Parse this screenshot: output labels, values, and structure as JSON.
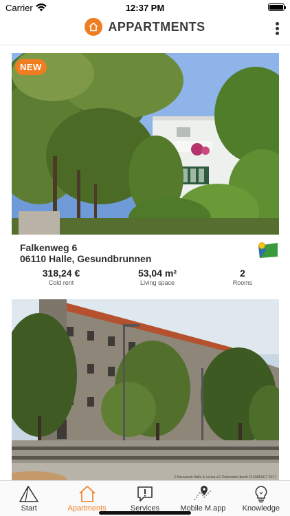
{
  "status_bar": {
    "carrier": "Carrier",
    "time": "12:37 PM"
  },
  "header": {
    "title": "APPARTMENTS"
  },
  "listings": [
    {
      "badge": "NEW",
      "street": "Falkenweg 6",
      "city": "06110 Halle, Gesundbrunnen",
      "cold_rent": "318,24 €",
      "cold_rent_label": "Cold rent",
      "living_space": "53,04 m²",
      "living_space_label": "Living space",
      "rooms": "2",
      "rooms_label": "Rooms"
    },
    {
      "photo_credit": "© Bauverein Halle & Leuna eG Präsentiert durch FLOWFACT 2017"
    }
  ],
  "tab_bar": {
    "items": [
      {
        "label": "Start",
        "icon": "triangle-icon"
      },
      {
        "label": "Apartments",
        "icon": "house-icon"
      },
      {
        "label": "Services",
        "icon": "chat-exclamation-icon"
      },
      {
        "label": "Mobile M.app",
        "icon": "map-pin-icon"
      },
      {
        "label": "Knowledge",
        "icon": "lightbulb-icon"
      }
    ],
    "active": "Apartments"
  },
  "colors": {
    "accent": "#ef7d21",
    "title": "#3c3c3c"
  }
}
